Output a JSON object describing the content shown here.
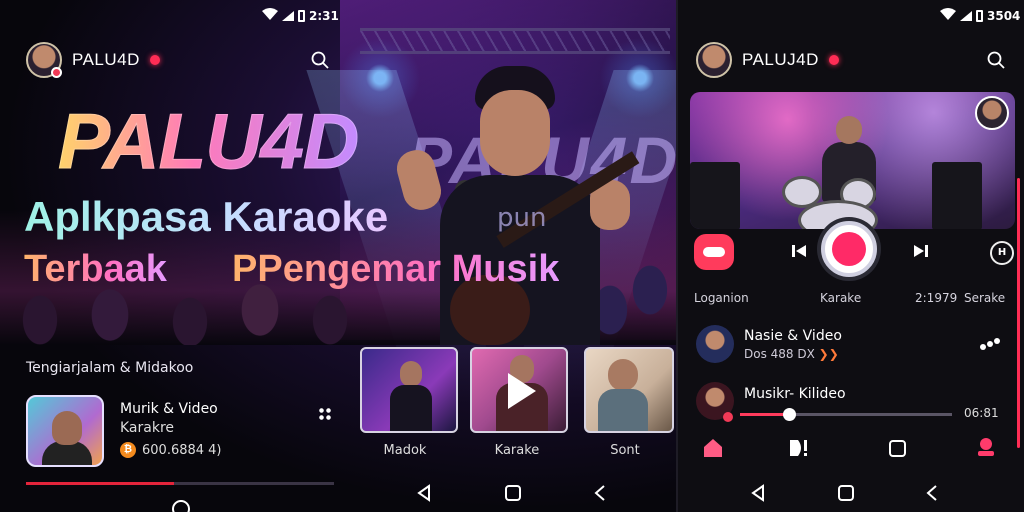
{
  "left": {
    "status_time": "2:31",
    "brand": "PALU4D",
    "hero": {
      "logo": "PALU4D",
      "subtitle": "Aplkpasa Karaoke",
      "line2_a": "Terbaak",
      "line2_b": "PPengemar Musik",
      "background_logo": "PALU4D",
      "overlay_text": "pun"
    },
    "section_label": "Tengiarjalam & Midakoo",
    "song": {
      "title": "Murik & Video",
      "artist": "Karakre",
      "count": "600.6884 4)"
    },
    "song_progress": 0.48,
    "thumbnails": [
      {
        "caption": "Madok"
      },
      {
        "caption": "Karake"
      },
      {
        "caption": "Sont"
      }
    ]
  },
  "right": {
    "status_time": "3504",
    "brand": "PALUJ4D",
    "controls": {
      "label_left": "Loganion",
      "label_mid": "Karake",
      "label_count": "2:1979",
      "label_right": "Serake",
      "circle_label": "H"
    },
    "list": [
      {
        "title": "Nasie & Video",
        "subtitle": "Dos 488 DX"
      },
      {
        "title": "Musikr- Kilideo",
        "time": "06:81"
      }
    ],
    "list_progress": 0.23
  },
  "colors": {
    "accent": "#ff2d55",
    "background": "#07060c"
  }
}
